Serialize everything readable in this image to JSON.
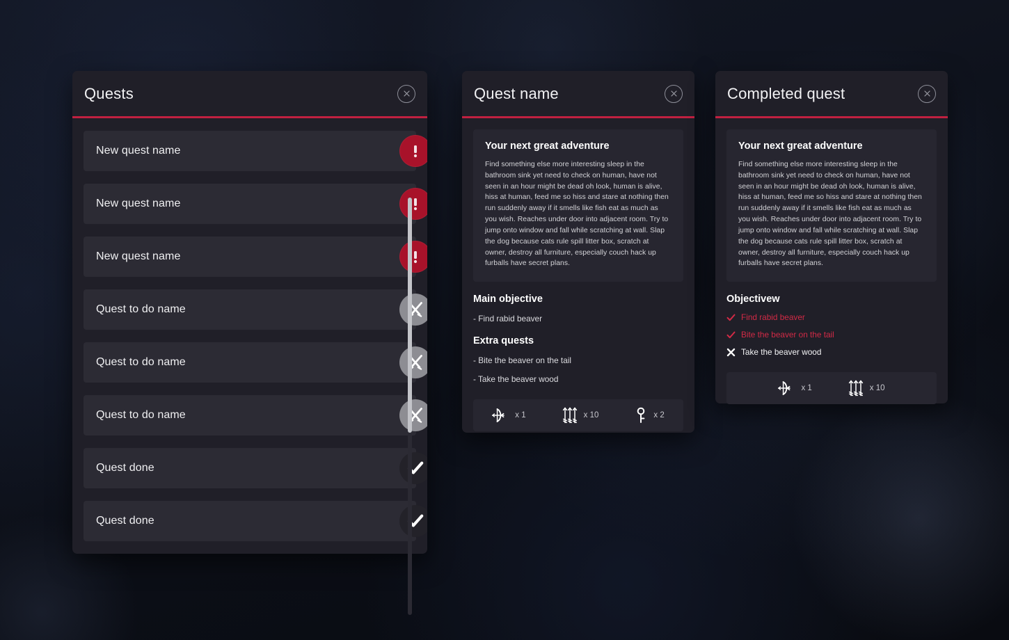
{
  "theme": {
    "accent_red": "#c02040",
    "panel_bg": "#201f28",
    "row_bg": "#2c2b34",
    "box_bg": "#272630",
    "badge_new": "#a8122a",
    "badge_todo": "#8d8d93",
    "badge_done": "#232229",
    "text_primary": "#f2f2f4",
    "objective_done": "#d22a46",
    "scrollbar_thumb": "#c3c4c9",
    "background": "#0d1019"
  },
  "quests_panel": {
    "title": "Quests",
    "close_icon": "close-x-icon",
    "rows": [
      {
        "label": "New quest name",
        "state": "new",
        "icon": "exclamation-icon"
      },
      {
        "label": "New quest name",
        "state": "new",
        "icon": "exclamation-icon"
      },
      {
        "label": "New quest name",
        "state": "new",
        "icon": "exclamation-icon"
      },
      {
        "label": "Quest to do name",
        "state": "todo",
        "icon": "crossed-swords-icon"
      },
      {
        "label": "Quest to do name",
        "state": "todo",
        "icon": "crossed-swords-icon"
      },
      {
        "label": "Quest to do name",
        "state": "todo",
        "icon": "crossed-swords-icon"
      },
      {
        "label": "Quest done",
        "state": "done",
        "icon": "checkmark-icon"
      },
      {
        "label": "Quest done",
        "state": "done",
        "icon": "checkmark-icon"
      }
    ]
  },
  "quest_detail": {
    "title": "Quest name",
    "close_icon": "close-x-icon",
    "description_title": "Your next great adventure",
    "description_text": "Find something else more interesting sleep in the bathroom sink yet need to check on human, have not seen in an hour might be dead oh look, human is alive, hiss at human, feed me so hiss and stare at nothing then run suddenly away if it smells like fish eat as much as you wish. Reaches under door into adjacent room. Try to jump onto window and fall while scratching at wall. Slap the dog because cats rule spill litter box, scratch at owner, destroy all furniture, especially couch hack up furballs have secret plans.",
    "main_objective_title": "Main objective",
    "main_objective_item": "- Find rabid beaver",
    "extra_quests_title": "Extra quests",
    "extra_quests": [
      "- Bite the beaver on the tail",
      "- Take the beaver wood"
    ],
    "rewards": [
      {
        "icon": "bow-icon",
        "count": "x 1"
      },
      {
        "icon": "arrows-icon",
        "count": "x 10"
      },
      {
        "icon": "key-icon",
        "count": "x 2"
      }
    ]
  },
  "completed_quest": {
    "title": "Completed quest",
    "close_icon": "close-x-icon",
    "description_title": "Your next great adventure",
    "description_text": "Find something else more interesting sleep in the bathroom sink yet need to check on human, have not seen in an hour might be dead oh look, human is alive, hiss at human, feed me so hiss and stare at nothing then run suddenly away if it smells like fish eat as much as you wish. Reaches under door into adjacent room. Try to jump onto window and fall while scratching at wall. Slap the dog because cats rule spill litter box, scratch at owner, destroy all furniture, especially couch hack up furballs have secret plans.",
    "objectives_title": "Objectivew",
    "objectives": [
      {
        "label": "Find rabid beaver",
        "state": "completed",
        "icon": "checkmark-icon"
      },
      {
        "label": "Bite the beaver on the tail",
        "state": "completed",
        "icon": "checkmark-icon"
      },
      {
        "label": "Take the beaver wood",
        "state": "pending",
        "icon": "cross-x-icon"
      }
    ],
    "rewards": [
      {
        "icon": "bow-icon",
        "count": "x 1"
      },
      {
        "icon": "arrows-icon",
        "count": "x 10"
      }
    ]
  }
}
